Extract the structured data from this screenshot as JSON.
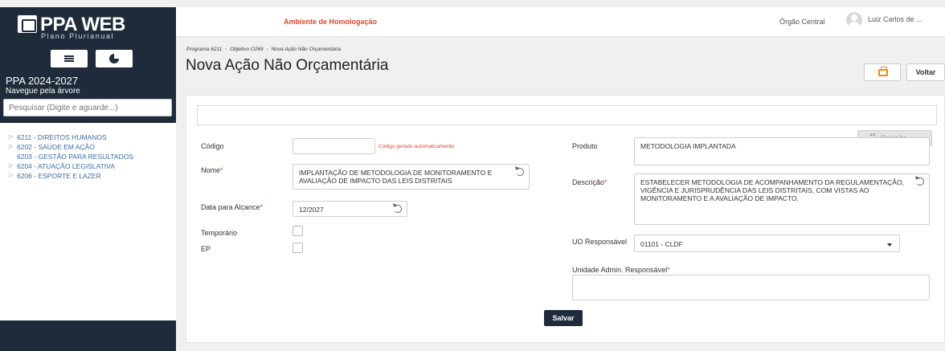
{
  "sidebar": {
    "logo_text": "PPA WEB",
    "logo_subtitle": "Plano Plurianual",
    "ppa_title": "PPA 2024-2027",
    "ppa_subtitle": "Navegue pela árvore",
    "search_placeholder": "Pesquisar (Digite e aguarde...)",
    "tree": [
      {
        "label": "6211 - DIREITOS HUMANOS",
        "expandable": true
      },
      {
        "label": "6202 - SAÚDE EM AÇÃO",
        "expandable": true
      },
      {
        "label": "6203 - GESTÃO PARA RESULTADOS",
        "expandable": false
      },
      {
        "label": "6204 - ATUAÇÃO LEGISLATIVA",
        "expandable": true
      },
      {
        "label": "6206 - ESPORTE E LAZER",
        "expandable": true
      }
    ]
  },
  "topbar": {
    "environment": "Ambiente de Homologação",
    "organization": "Órgão Central",
    "user": "Luiz Carlos de ..."
  },
  "breadcrumb": {
    "items": [
      "Programa 6211",
      "Objetivo O269",
      "Nova Ação Não Orçamentária"
    ],
    "separator": "›"
  },
  "page": {
    "title": "Nova Ação Não Orçamentária",
    "voltar_label": "Voltar"
  },
  "form": {
    "revisao_label": "Revisão",
    "codigo": {
      "label": "Código",
      "value": "",
      "hint": "Código gerado automaticamente"
    },
    "nome": {
      "label": "Nome",
      "required": "*",
      "value": "IMPLANTAÇÃO DE METODOLOGIA DE MONITORAMENTO E AVALIAÇÃO DE IMPACTO DAS LEIS DISTRITAIS"
    },
    "data_alcance": {
      "label": "Data para Alcance",
      "required": "*",
      "value": "12/2027"
    },
    "temporario": {
      "label": "Temporário",
      "checked": false
    },
    "ep": {
      "label": "EP",
      "checked": false
    },
    "produto": {
      "label": "Produto",
      "value": "METODOLOGIA IMPLANTADA"
    },
    "descricao": {
      "label": "Descrição",
      "required": "*",
      "value": "ESTABELECER METODOLOGIA DE ACOMPANHAMENTO DA REGULAMENTAÇÃO, VIGÊNCIA E JURISPRUDÊNCIA DAS LEIS DISTRITAIS, COM VISTAS AO MONITORAMENTO E A AVALIAÇÃO DE IMPACTO."
    },
    "uo_responsavel": {
      "label": "UO Responsável",
      "value": "01101 - CLDF"
    },
    "unidade_admin": {
      "label": "Unidade Admin. Responsável",
      "required": "*",
      "value": ""
    },
    "salvar_label": "Salvar"
  },
  "colors": {
    "sidebar_bg": "#1f2b3a",
    "accent_red": "#e0472f",
    "print_orange": "#f08c1a",
    "tree_link": "#3a6ea5"
  },
  "icons": [
    "menu-icon",
    "pie-chart-icon",
    "printer-icon",
    "gear-icon",
    "undo-icon",
    "user-avatar-icon",
    "chevron-down-icon"
  ]
}
